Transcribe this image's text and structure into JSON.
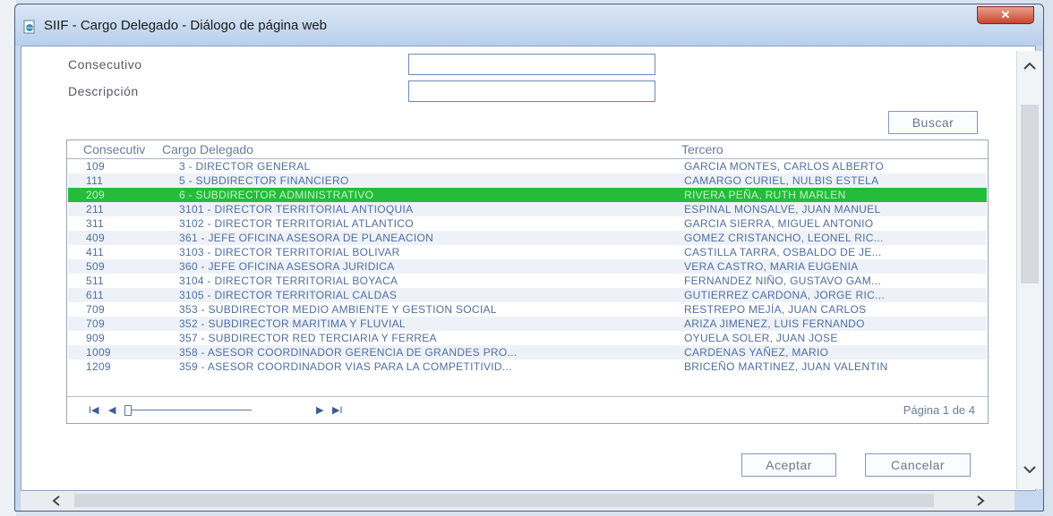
{
  "window": {
    "title": "SIIF - Cargo Delegado - Diálogo de página web",
    "close_label": "✕"
  },
  "form": {
    "consecutivo_label": "Consecutivo",
    "consecutivo_value": "",
    "descripcion_label": "Descripción",
    "descripcion_value": "",
    "buscar_label": "Buscar"
  },
  "grid": {
    "headers": [
      "Consecutiv",
      "Cargo Delegado",
      "Tercero"
    ],
    "rows": [
      {
        "consecutivo": "109",
        "cargo": "3 - DIRECTOR GENERAL",
        "tercero": "GARCIA MONTES, CARLOS ALBERTO",
        "selected": false
      },
      {
        "consecutivo": "111",
        "cargo": "5 - SUBDIRECTOR FINANCIERO",
        "tercero": "CAMARGO CURIEL, NULBIS ESTELA",
        "selected": false
      },
      {
        "consecutivo": "209",
        "cargo": "6 - SUBDIRECTOR ADMINISTRATIVO",
        "tercero": "RIVERA PEÑA, RUTH MARLEN",
        "selected": true
      },
      {
        "consecutivo": "211",
        "cargo": "3101 - DIRECTOR TERRITORIAL ANTIOQUIA",
        "tercero": "ESPINAL MONSALVE, JUAN MANUEL",
        "selected": false
      },
      {
        "consecutivo": "311",
        "cargo": "3102 - DIRECTOR TERRITORIAL ATLANTICO",
        "tercero": "GARCIA SIERRA, MIGUEL ANTONIO",
        "selected": false
      },
      {
        "consecutivo": "409",
        "cargo": "361 - JEFE OFICINA ASESORA DE PLANEACION",
        "tercero": "GOMEZ CRISTANCHO, LEONEL RIC...",
        "selected": false
      },
      {
        "consecutivo": "411",
        "cargo": "3103 - DIRECTOR TERRITORIAL BOLIVAR",
        "tercero": "CASTILLA TARRA, OSBALDO DE JE...",
        "selected": false
      },
      {
        "consecutivo": "509",
        "cargo": "360 - JEFE OFICINA ASESORA JURIDICA",
        "tercero": "VERA CASTRO, MARIA EUGENIA",
        "selected": false
      },
      {
        "consecutivo": "511",
        "cargo": "3104 - DIRECTOR TERRITORIAL BOYACA",
        "tercero": "FERNANDEZ NIÑO, GUSTAVO GAM...",
        "selected": false
      },
      {
        "consecutivo": "611",
        "cargo": "3105 - DIRECTOR TERRITORIAL CALDAS",
        "tercero": "GUTIERREZ CARDONA, JORGE RIC...",
        "selected": false
      },
      {
        "consecutivo": "709",
        "cargo": "353 - SUBDIRECTOR MEDIO AMBIENTE Y GESTION SOCIAL",
        "tercero": "RESTREPO MEJÍA, JUAN CARLOS",
        "selected": false
      },
      {
        "consecutivo": "709",
        "cargo": "352 - SUBDIRECTOR MARITIMA Y FLUVIAL",
        "tercero": "ARIZA JIMENEZ, LUIS FERNANDO",
        "selected": false
      },
      {
        "consecutivo": "909",
        "cargo": "357 - SUBDIRECTOR RED TERCIARIA Y FERREA",
        "tercero": "OYUELA SOLER, JUAN JOSE",
        "selected": false
      },
      {
        "consecutivo": "1009",
        "cargo": "358 - ASESOR COORDINADOR GERENCIA DE GRANDES PRO...",
        "tercero": "CARDENAS YAÑEZ, MARIO",
        "selected": false
      },
      {
        "consecutivo": "1209",
        "cargo": "359 - ASESOR COORDINADOR VIAS PARA LA COMPETITIVID...",
        "tercero": "BRICEÑO MARTINEZ, JUAN VALENTIN",
        "selected": false
      }
    ],
    "pager": {
      "first": "I◀",
      "prev": "◀",
      "next": "▶",
      "last": "▶I",
      "page_info": "Página 1 de 4"
    }
  },
  "footer": {
    "aceptar_label": "Aceptar",
    "cancelar_label": "Cancelar"
  },
  "icons": {
    "app": "ie-page-icon",
    "close": "close-icon",
    "scroll_up": "chevron-up-icon",
    "scroll_down": "chevron-down-icon",
    "scroll_left": "chevron-left-icon",
    "scroll_right": "chevron-right-icon"
  },
  "colors": {
    "selected_row": "#25bc3c",
    "row_text": "#4f6ea3",
    "titlebar": "#c6d8ef"
  }
}
